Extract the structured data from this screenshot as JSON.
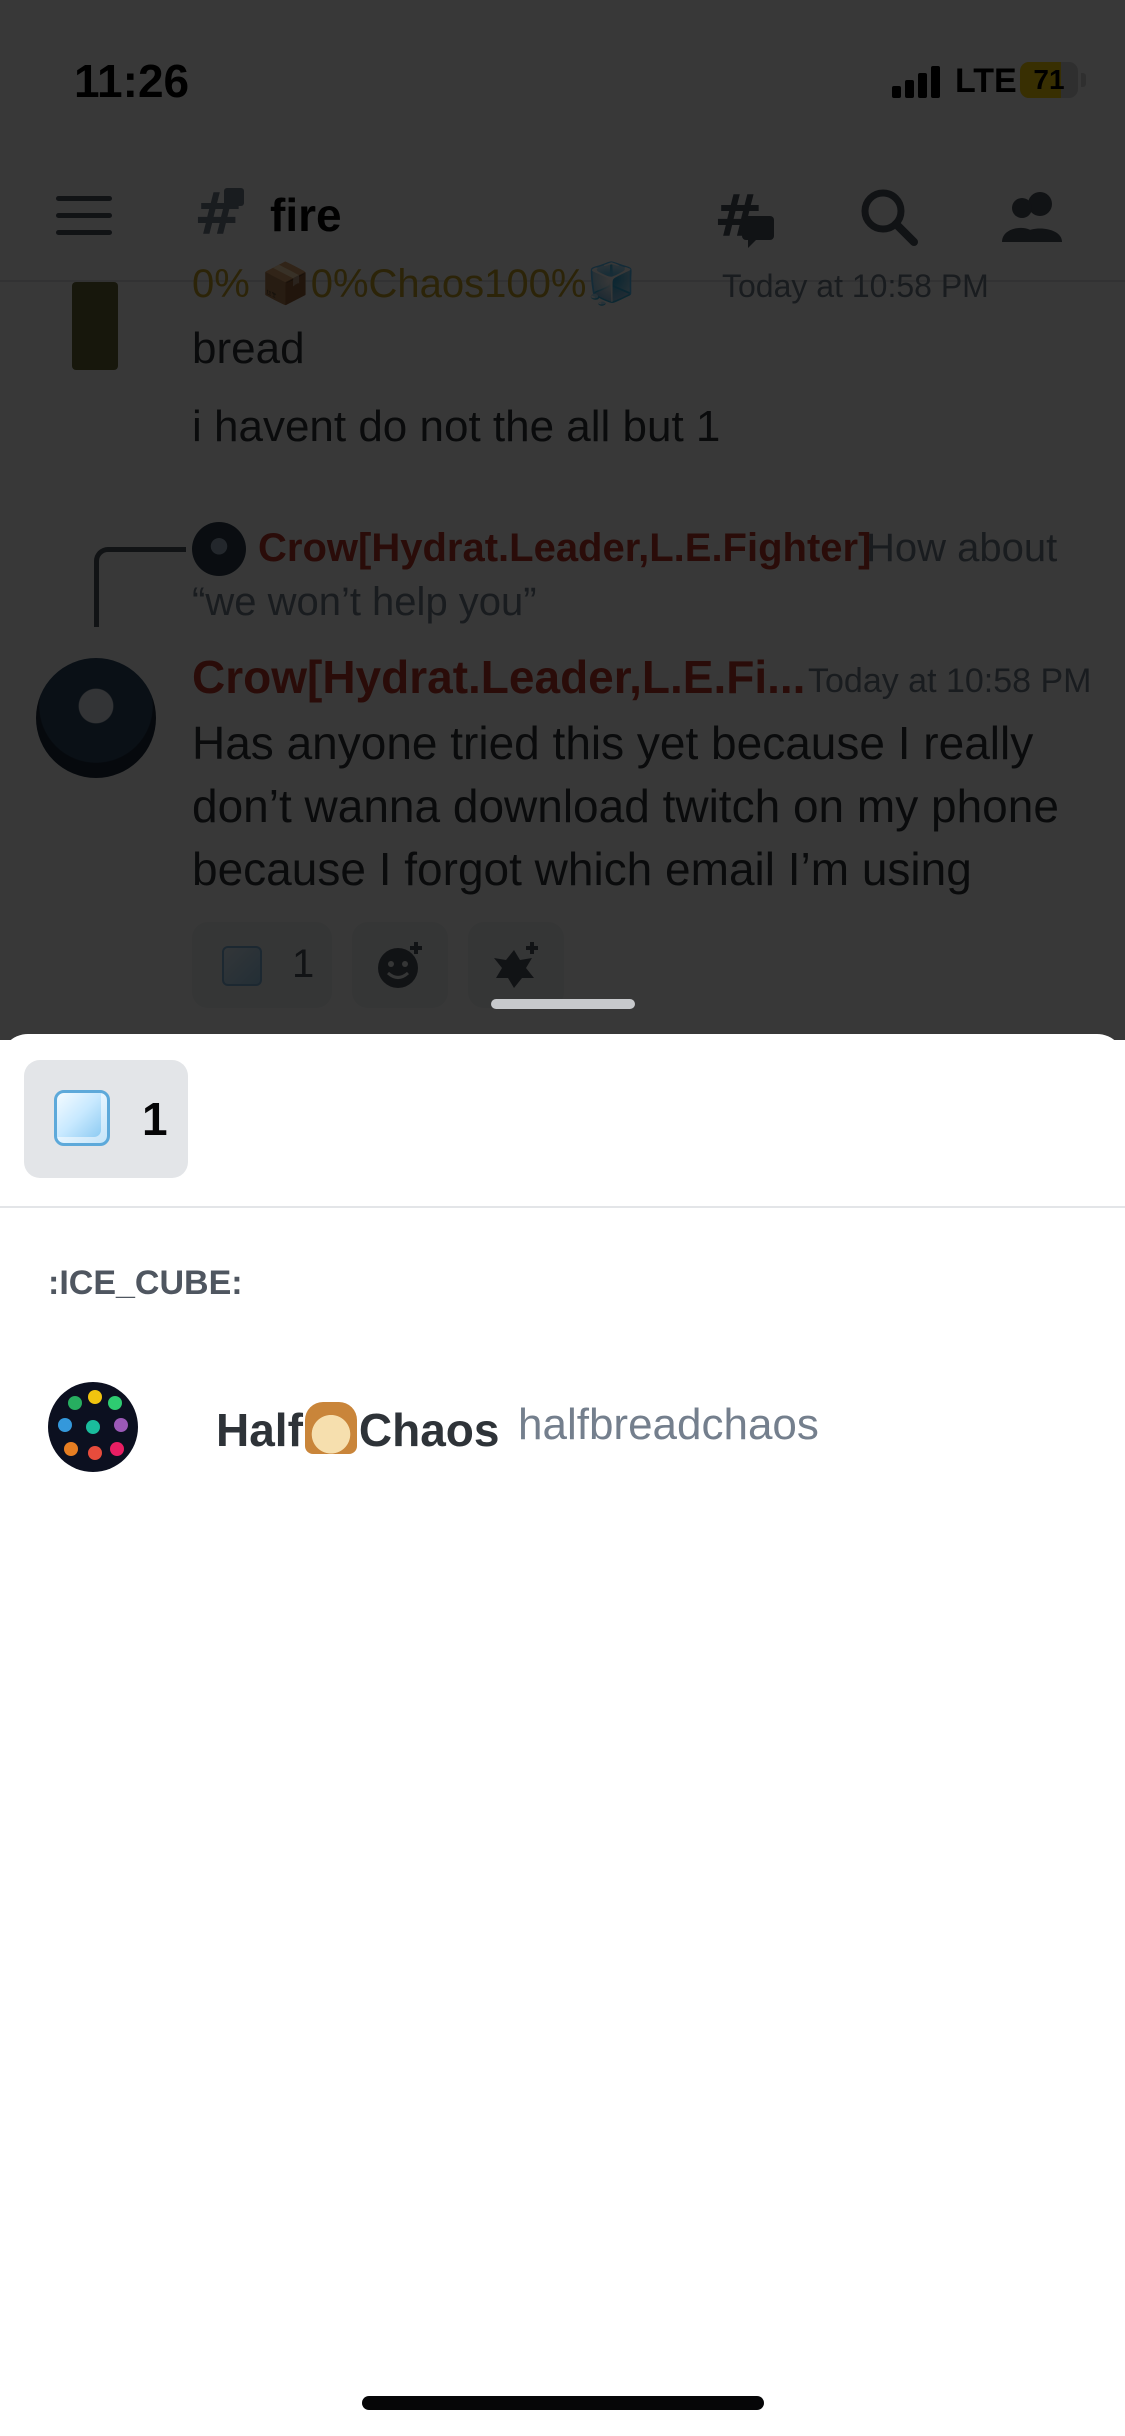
{
  "status_bar": {
    "time": "11:26",
    "network": "LTE",
    "battery": "71",
    "battery_level": 0.71
  },
  "channel_header": {
    "channel_name": "fire",
    "icons": [
      "menu-icon",
      "locked-channel-icon",
      "threads-icon",
      "search-icon",
      "members-icon"
    ]
  },
  "messages": {
    "previous": {
      "author": "0% 📦0%Chaos100%🧊",
      "time": "Today at 10:58 PM",
      "lines": [
        "bread",
        "i havent do not the all but 1"
      ]
    },
    "reply": {
      "author": "Crow[Hydrat.Leader,L.E.Fighter]",
      "text_line1": "How about",
      "text_line2": "“we won’t help you”"
    },
    "main": {
      "author": "Crow[Hydrat.Leader,L.E.Fi...",
      "time": "Today at 10:58 PM",
      "text": "Has anyone tried this yet because I really don’t wanna download twitch on my phone because I forgot which email I’m using",
      "reaction_count": "1"
    }
  },
  "sheet": {
    "tab": {
      "emoji": "ice-cube-emoji",
      "count": "1"
    },
    "emoji_name": ":ICE_CUBE:",
    "users": [
      {
        "display_first": "Half",
        "display_second": "Chaos",
        "username": "halfbreadchaos"
      }
    ]
  },
  "colors": {
    "author_red": "#c0392b",
    "muted_text": "#747f8d",
    "sheet_background": "#ffffff",
    "tab_background": "#e3e5e8",
    "battery_yellow": "#ffd60a"
  }
}
